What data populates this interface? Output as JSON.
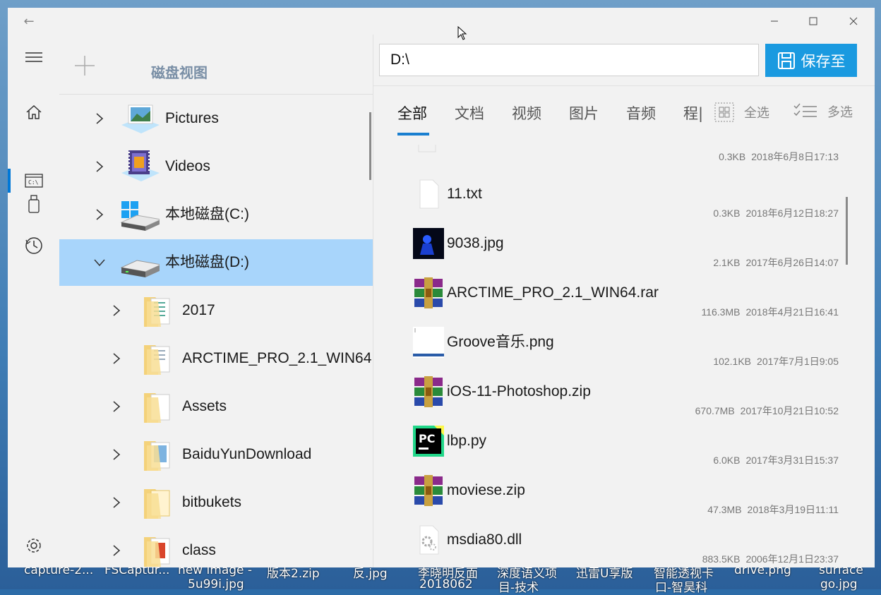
{
  "window": {
    "back_label": "←",
    "minimize_label": "—",
    "maximize_label": "☐",
    "close_label": "✕"
  },
  "rail": {
    "items": [
      "menu-icon",
      "home-icon",
      "drive-icon",
      "usb-icon",
      "history-icon",
      "settings-icon"
    ],
    "active": "drive-icon",
    "drive_glyph": "C:\\"
  },
  "tree": {
    "title": "磁盘视图",
    "items": [
      {
        "label": "Pictures",
        "expanded": false,
        "level": 1,
        "icon": "pictures-library-icon"
      },
      {
        "label": "Videos",
        "expanded": false,
        "level": 1,
        "icon": "videos-library-icon"
      },
      {
        "label": "本地磁盘(C:)",
        "expanded": false,
        "level": 1,
        "icon": "windows-drive-icon"
      },
      {
        "label": "本地磁盘(D:)",
        "expanded": true,
        "selected": true,
        "level": 1,
        "icon": "drive-icon"
      },
      {
        "label": "2017",
        "expanded": false,
        "level": 2,
        "icon": "folder-icon"
      },
      {
        "label": "ARCTIME_PRO_2.1_WIN64",
        "expanded": false,
        "level": 2,
        "icon": "folder-icon"
      },
      {
        "label": "Assets",
        "expanded": false,
        "level": 2,
        "icon": "folder-icon"
      },
      {
        "label": "BaiduYunDownload",
        "expanded": false,
        "level": 2,
        "icon": "folder-icon"
      },
      {
        "label": "bitbukets",
        "expanded": false,
        "level": 2,
        "icon": "folder-icon"
      },
      {
        "label": "class",
        "expanded": false,
        "level": 2,
        "icon": "folder-icon"
      }
    ]
  },
  "path": {
    "value": "D:\\"
  },
  "save_button": {
    "label": "保存至"
  },
  "tabs": {
    "items": [
      "全部",
      "文档",
      "视频",
      "图片",
      "音频",
      "程|"
    ],
    "active": "全部"
  },
  "tools": {
    "select_all": "全选",
    "multi_select": "多选"
  },
  "files": [
    {
      "name": "",
      "size": "0.3KB",
      "date": "2018年6月8日17:13",
      "icon": "blank-file-icon"
    },
    {
      "name": "11.txt",
      "size": "0.3KB",
      "date": "2018年6月12日18:27",
      "icon": "text-file-icon"
    },
    {
      "name": "9038.jpg",
      "size": "2.1KB",
      "date": "2017年6月26日14:07",
      "icon": "image-thumbnail-icon"
    },
    {
      "name": "ARCTIME_PRO_2.1_WIN64.rar",
      "size": "116.3MB",
      "date": "2018年4月21日16:41",
      "icon": "winrar-archive-icon"
    },
    {
      "name": "Groove音乐.png",
      "size": "102.1KB",
      "date": "2017年7月1日9:05",
      "icon": "image-thumbnail-icon"
    },
    {
      "name": "iOS-11-Photoshop.zip",
      "size": "670.7MB",
      "date": "2017年10月21日10:52",
      "icon": "winrar-archive-icon"
    },
    {
      "name": "lbp.py",
      "size": "6.0KB",
      "date": "2017年3月31日15:37",
      "icon": "pycharm-file-icon"
    },
    {
      "name": "moviese.zip",
      "size": "47.3MB",
      "date": "2018年3月19日11:11",
      "icon": "winrar-archive-icon"
    },
    {
      "name": "msdia80.dll",
      "size": "883.5KB",
      "date": "2006年12月1日23:37",
      "icon": "dll-file-icon"
    }
  ],
  "taskbar": {
    "labels": [
      "capture-2...",
      "FSCaptur...",
      "new image -",
      "5u99i.jpg",
      "版本2.zip",
      "反.jpg",
      "李晓明反面",
      "2018062",
      "深度语义项",
      "目-技术",
      "迅雷U享版",
      "智能透视卡",
      "口-智昊科",
      "drive.png",
      "surface",
      "go.jpg"
    ]
  },
  "colors": {
    "accent": "#1a9ae0",
    "selection": "#a8d5fb",
    "tab_underline": "#1a7fd0"
  }
}
